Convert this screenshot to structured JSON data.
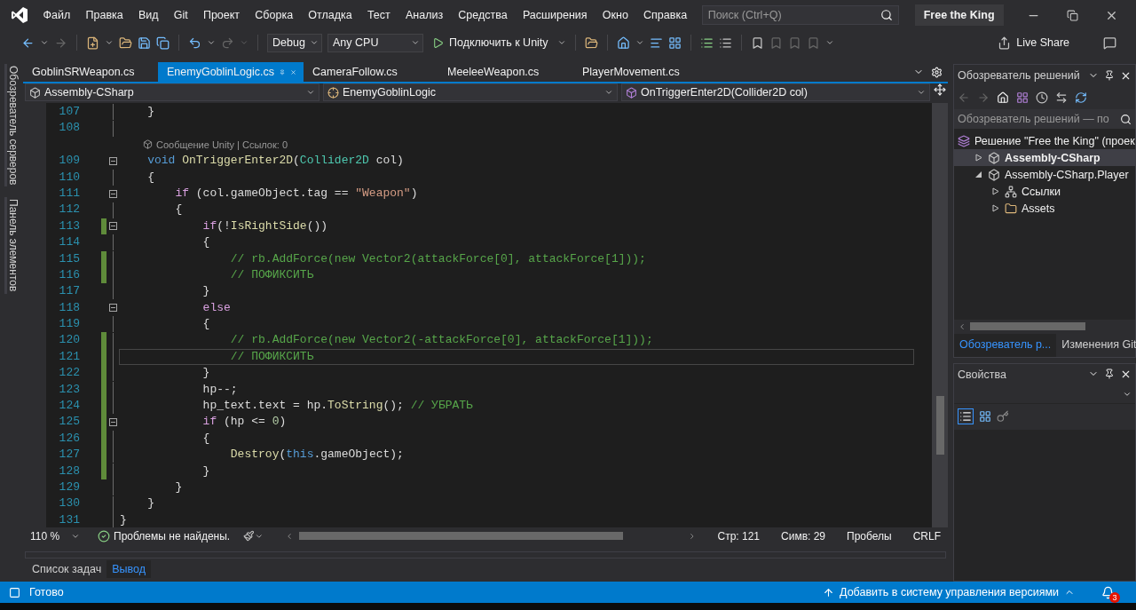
{
  "menu": [
    "Файл",
    "Правка",
    "Вид",
    "Git",
    "Проект",
    "Сборка",
    "Отладка",
    "Тест",
    "Анализ",
    "Средства",
    "Расширения",
    "Окно",
    "Справка"
  ],
  "search": {
    "placeholder": "Поиск (Ctrl+Q)"
  },
  "window": {
    "title": "Free the King"
  },
  "toolbar": {
    "configuration": "Debug",
    "platform": "Any CPU",
    "run": "Подключить к Unity",
    "live_share": "Live Share"
  },
  "side_tabs": [
    "Обозреватель серверов",
    "Панель элементов"
  ],
  "tabs": [
    {
      "label": "GoblinSRWeapon.cs",
      "selected": false
    },
    {
      "label": "EnemyGoblinLogic.cs",
      "selected": true
    },
    {
      "label": "CameraFollow.cs",
      "selected": false
    },
    {
      "label": "MeeleeWeapon.cs",
      "selected": false
    },
    {
      "label": "PlayerMovement.cs",
      "selected": false
    }
  ],
  "navigation": {
    "project": "Assembly-CSharp",
    "type": "EnemyGoblinLogic",
    "member": "OnTriggerEnter2D(Collider2D col)"
  },
  "code_lines": [
    {
      "kind": "code",
      "number": "107",
      "changed": false,
      "fold": false,
      "current": false,
      "tokens": [
        {
          "kind": "plain",
          "text": "    }"
        }
      ]
    },
    {
      "kind": "code",
      "number": "108",
      "changed": false,
      "fold": false,
      "current": false
    },
    {
      "kind": "lens",
      "text": "Сообщение Unity | Ссылок: 0"
    },
    {
      "kind": "code",
      "number": "109",
      "changed": false,
      "fold": true,
      "current": false,
      "tokens": [
        {
          "kind": "keyword",
          "text": "    void "
        },
        {
          "kind": "function",
          "text": "OnTriggerEnter2D"
        },
        {
          "kind": "plain",
          "text": "("
        },
        {
          "kind": "type",
          "text": "Collider2D"
        },
        {
          "kind": "plain",
          "text": " col)"
        }
      ]
    },
    {
      "kind": "code",
      "number": "110",
      "changed": false,
      "fold": false,
      "current": false,
      "tokens": [
        {
          "kind": "plain",
          "text": "    {"
        }
      ]
    },
    {
      "kind": "code",
      "number": "111",
      "changed": false,
      "fold": true,
      "current": false,
      "tokens": [
        {
          "kind": "control",
          "text": "        if"
        },
        {
          "kind": "plain",
          "text": " (col.gameObject.tag == "
        },
        {
          "kind": "string",
          "text": "\"Weapon\""
        },
        {
          "kind": "plain",
          "text": ")"
        }
      ]
    },
    {
      "kind": "code",
      "number": "112",
      "changed": false,
      "fold": false,
      "current": false,
      "tokens": [
        {
          "kind": "plain",
          "text": "        {"
        }
      ]
    },
    {
      "kind": "code",
      "number": "113",
      "changed": true,
      "fold": true,
      "current": false,
      "tokens": [
        {
          "kind": "control",
          "text": "            if"
        },
        {
          "kind": "plain",
          "text": "(!"
        },
        {
          "kind": "function",
          "text": "IsRightSide"
        },
        {
          "kind": "plain",
          "text": "())"
        }
      ]
    },
    {
      "kind": "code",
      "number": "114",
      "changed": false,
      "fold": false,
      "current": false,
      "tokens": [
        {
          "kind": "plain",
          "text": "            {"
        }
      ]
    },
    {
      "kind": "code",
      "number": "115",
      "changed": true,
      "fold": false,
      "current": false,
      "tokens": [
        {
          "kind": "comment",
          "text": "                // rb.AddForce(new Vector2(attackForce[0], attackForce[1]));"
        }
      ]
    },
    {
      "kind": "code",
      "number": "116",
      "changed": true,
      "fold": false,
      "current": false,
      "tokens": [
        {
          "kind": "comment",
          "text": "                // ПОФИКСИТЬ"
        }
      ]
    },
    {
      "kind": "code",
      "number": "117",
      "changed": false,
      "fold": false,
      "current": false,
      "tokens": [
        {
          "kind": "plain",
          "text": "            }"
        }
      ]
    },
    {
      "kind": "code",
      "number": "118",
      "changed": false,
      "fold": true,
      "current": false,
      "tokens": [
        {
          "kind": "control",
          "text": "            else"
        }
      ]
    },
    {
      "kind": "code",
      "number": "119",
      "changed": false,
      "fold": false,
      "current": false,
      "tokens": [
        {
          "kind": "plain",
          "text": "            {"
        }
      ]
    },
    {
      "kind": "code",
      "number": "120",
      "changed": true,
      "fold": false,
      "current": false,
      "tokens": [
        {
          "kind": "comment",
          "text": "                // rb.AddForce(new Vector2(-attackForce[0], attackForce[1]));"
        }
      ]
    },
    {
      "kind": "code",
      "number": "121",
      "changed": true,
      "fold": false,
      "current": true,
      "tokens": [
        {
          "kind": "comment",
          "text": "                // ПОФИКСИТЬ"
        }
      ]
    },
    {
      "kind": "code",
      "number": "122",
      "changed": true,
      "fold": false,
      "current": false,
      "tokens": [
        {
          "kind": "plain",
          "text": "            }"
        }
      ]
    },
    {
      "kind": "code",
      "number": "123",
      "changed": true,
      "fold": false,
      "current": false,
      "tokens": [
        {
          "kind": "plain",
          "text": "            hp--;"
        }
      ]
    },
    {
      "kind": "code",
      "number": "124",
      "changed": true,
      "fold": false,
      "current": false,
      "tokens": [
        {
          "kind": "plain",
          "text": "            hp_text.text = hp."
        },
        {
          "kind": "function",
          "text": "ToString"
        },
        {
          "kind": "plain",
          "text": "(); "
        },
        {
          "kind": "comment",
          "text": "// УБРАТЬ"
        }
      ]
    },
    {
      "kind": "code",
      "number": "125",
      "changed": true,
      "fold": true,
      "current": false,
      "tokens": [
        {
          "kind": "control",
          "text": "            if"
        },
        {
          "kind": "plain",
          "text": " (hp <= "
        },
        {
          "kind": "number",
          "text": "0"
        },
        {
          "kind": "plain",
          "text": ")"
        }
      ]
    },
    {
      "kind": "code",
      "number": "126",
      "changed": true,
      "fold": false,
      "current": false,
      "tokens": [
        {
          "kind": "plain",
          "text": "            {"
        }
      ]
    },
    {
      "kind": "code",
      "number": "127",
      "changed": true,
      "fold": false,
      "current": false,
      "tokens": [
        {
          "kind": "function",
          "text": "                Destroy"
        },
        {
          "kind": "plain",
          "text": "("
        },
        {
          "kind": "keyword",
          "text": "this"
        },
        {
          "kind": "plain",
          "text": ".gameObject);"
        }
      ]
    },
    {
      "kind": "code",
      "number": "128",
      "changed": true,
      "fold": false,
      "current": false,
      "tokens": [
        {
          "kind": "plain",
          "text": "            }"
        }
      ]
    },
    {
      "kind": "code",
      "number": "129",
      "changed": false,
      "fold": false,
      "current": false,
      "tokens": [
        {
          "kind": "plain",
          "text": "        }"
        }
      ]
    },
    {
      "kind": "code",
      "number": "130",
      "changed": false,
      "fold": false,
      "current": false,
      "tokens": [
        {
          "kind": "plain",
          "text": "    }"
        }
      ]
    },
    {
      "kind": "code",
      "number": "131",
      "changed": false,
      "fold": false,
      "current": false,
      "tokens": [
        {
          "kind": "plain",
          "text": "}"
        }
      ]
    }
  ],
  "editor_status": {
    "zoom": "110 %",
    "issues": "Проблемы не найдены.",
    "line": "Стр: 121",
    "column": "Симв: 29",
    "whitespace": "Пробелы",
    "line_endings": "CRLF"
  },
  "bottom_tabs": [
    {
      "label": "Список задач",
      "selected": false
    },
    {
      "label": "Вывод",
      "selected": true
    }
  ],
  "solution_explorer": {
    "title": "Обозреватель решений",
    "search": {
      "placeholder": "Обозреватель решений — по"
    },
    "tree": [
      {
        "kind": "solution",
        "label": "Решение \"Free the King\" (проек",
        "selected": false,
        "startup": false,
        "children": [
          {
            "kind": "project",
            "label": "Assembly-CSharp",
            "selected": true,
            "startup": true,
            "expanded": false
          },
          {
            "kind": "project",
            "label": "Assembly-CSharp.Player",
            "selected": false,
            "startup": false,
            "expanded": true,
            "children": [
              {
                "kind": "references",
                "label": "Ссылки",
                "selected": false,
                "startup": false,
                "expanded": false
              },
              {
                "kind": "folder",
                "label": "Assets",
                "selected": false,
                "startup": false,
                "expanded": false
              }
            ]
          }
        ]
      }
    ],
    "tabs": [
      {
        "label": "Обозреватель р...",
        "selected": true
      },
      {
        "label": "Изменения Git",
        "selected": false
      }
    ]
  },
  "properties": {
    "title": "Свойства"
  },
  "status_bar": {
    "text": "Готово",
    "source_control": "Добавить в систему управления версиями",
    "notifications": "3"
  }
}
